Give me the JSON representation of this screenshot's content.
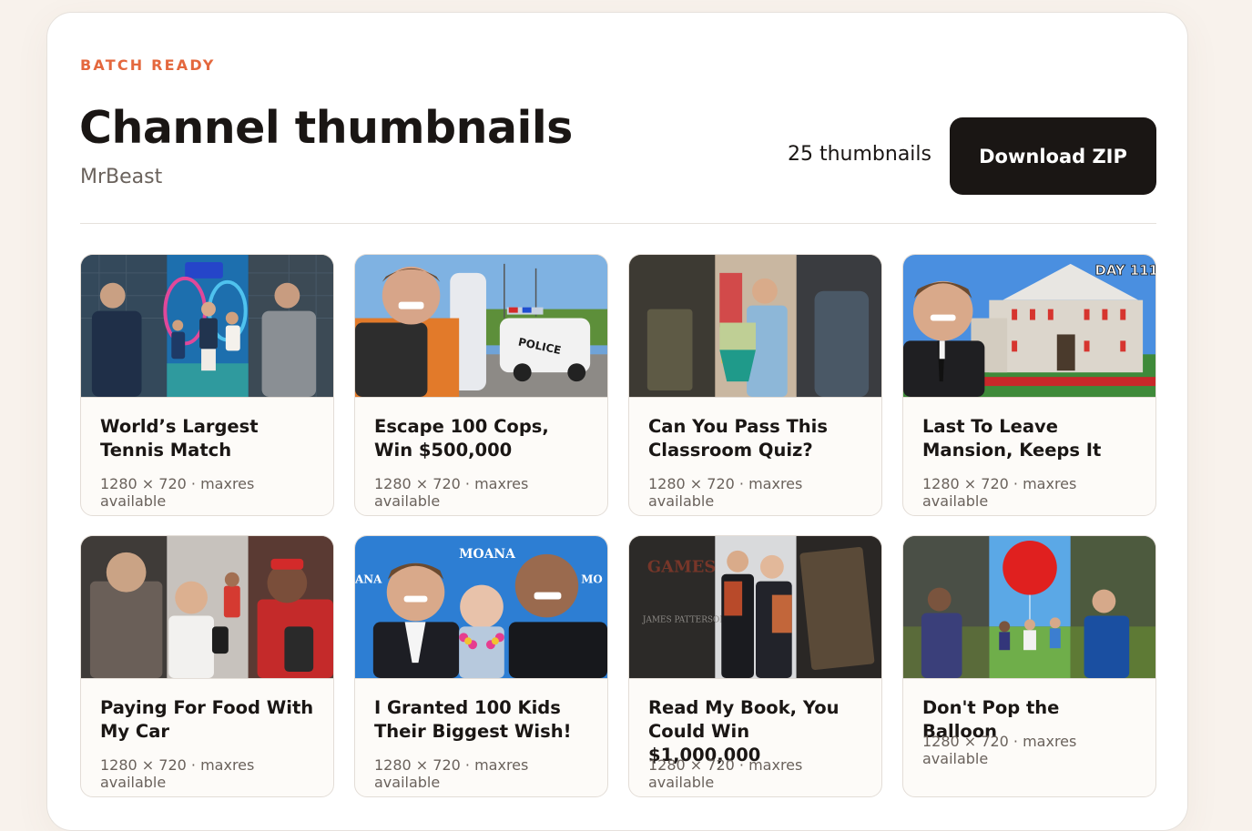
{
  "header": {
    "eyebrow": "BATCH READY",
    "title": "Channel thumbnails",
    "channel": "MrBeast",
    "count_label": "25 thumbnails",
    "download_label": "Download ZIP"
  },
  "colors": {
    "accent": "#e4683e",
    "dark": "#1a1614",
    "muted": "#6a625c",
    "page_bg": "#f8f2ec"
  },
  "thumbnails": [
    {
      "title": "World’s Largest Tennis Match",
      "meta": "1280 × 720 · maxres available"
    },
    {
      "title": "Escape 100 Cops, Win $500,000",
      "meta": "1280 × 720 · maxres available"
    },
    {
      "title": "Can You Pass This Classroom Quiz?",
      "meta": "1280 × 720 · maxres available"
    },
    {
      "title": "Last To Leave Mansion, Keeps It",
      "meta": "1280 × 720 · maxres available",
      "badge": "DAY 111"
    },
    {
      "title": "Paying For Food With My Car",
      "meta": "1280 × 720 · maxres available"
    },
    {
      "title": "I Granted 100 Kids Their Biggest Wish!",
      "meta": "1280 × 720 · maxres available",
      "sign_left": "ANA",
      "sign_top": "MOANA",
      "sign_right": "MO"
    },
    {
      "title": "Read My Book, You Could Win $1,000,000",
      "meta": "1280 × 720 · maxres available",
      "book_title": "GAMES",
      "book_author": "JAMES PATTERSON"
    },
    {
      "title": "Don't Pop the Balloon",
      "meta": "1280 × 720 · maxres available"
    }
  ]
}
